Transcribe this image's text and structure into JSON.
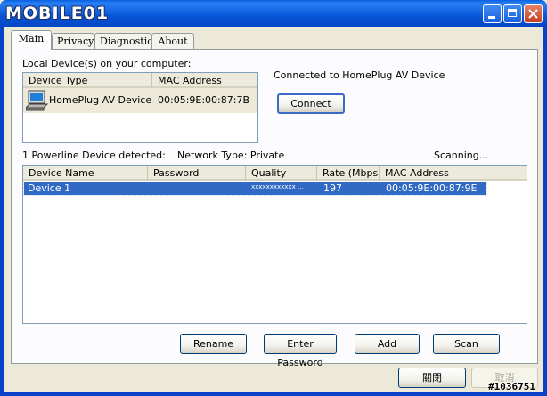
{
  "window": {
    "title": "MOBILE01",
    "controls": {
      "minimize": "minimize-icon",
      "maximize": "maximize-icon",
      "close": "close-icon"
    }
  },
  "tabs": [
    {
      "label": "Main",
      "active": true
    },
    {
      "label": "Privacy",
      "active": false
    },
    {
      "label": "Diagnostics",
      "active": false
    },
    {
      "label": "About",
      "active": false
    }
  ],
  "local": {
    "section_label": "Local Device(s) on your computer:",
    "columns": [
      "Device Type",
      "MAC Address"
    ],
    "rows": [
      {
        "icon": "computer-icon",
        "type": "HomePlug AV Device",
        "mac": "00:05:9E:00:87:7B"
      }
    ],
    "status": "Connected to HomePlug AV Device",
    "connect_label": "Connect"
  },
  "powerline": {
    "detected_label": "1 Powerline Device detected:",
    "network_type_label": "Network Type: Private",
    "scanning_label": "Scanning...",
    "columns": [
      "Device Name",
      "Password",
      "Quality",
      "Rate (Mbps)",
      "MAC Address"
    ],
    "rows": [
      {
        "name": "Device 1",
        "password": "",
        "quality": "xxxxxxxxxxxx ...",
        "rate": "197",
        "mac": "00:05:9E:00:87:9E",
        "selected": true
      }
    ]
  },
  "actions": {
    "rename": "Rename",
    "enter_password": "Enter Password",
    "add": "Add",
    "scan": "Scan"
  },
  "footer": {
    "close": "關閉",
    "cancel": "取消",
    "watermark": "#1036751"
  }
}
